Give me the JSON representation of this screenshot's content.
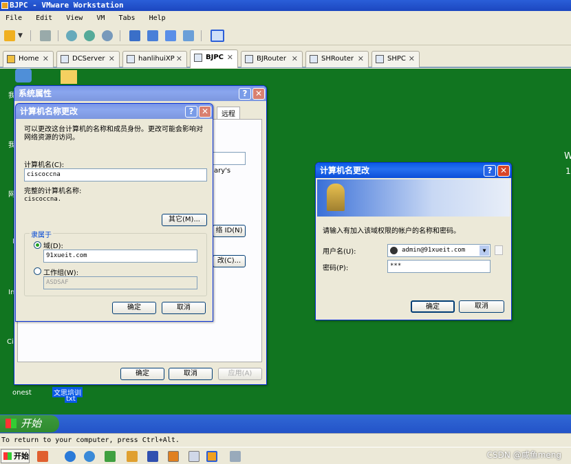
{
  "vmware": {
    "title": "BJPC - VMware Workstation",
    "menu": [
      "File",
      "Edit",
      "View",
      "VM",
      "Tabs",
      "Help"
    ],
    "tabs": [
      {
        "label": "Home",
        "active": false
      },
      {
        "label": "DCServer",
        "active": false
      },
      {
        "label": "hanlihuiXP",
        "active": false
      },
      {
        "label": "BJPC",
        "active": true
      },
      {
        "label": "BJRouter",
        "active": false
      },
      {
        "label": "SHRouter",
        "active": false
      },
      {
        "label": "SHPC",
        "active": false
      }
    ],
    "status": "To return to your computer, press Ctrl+Alt.",
    "host_start": "开始",
    "watermark": "CSDN @咸鱼meng"
  },
  "guest": {
    "start": "开始",
    "desktop_labels": [
      "onest",
      "文思培训",
      "txt"
    ]
  },
  "sys_props": {
    "title": "系统属性",
    "tab_remote": "远程",
    "partial_text": "ary's",
    "partial_btn1": "络 ID(N)",
    "partial_btn2": "改(C)...",
    "ok": "确定",
    "cancel": "取消",
    "apply": "应用(A)"
  },
  "name_change": {
    "title": "计算机名称更改",
    "desc": "可以更改这台计算机的名称和成员身份。更改可能会影响对网络资源的访问。",
    "computer_name_label": "计算机名(C):",
    "computer_name": "ciscoccna",
    "full_name_label": "完整的计算机名称:",
    "full_name": "ciscoccna.",
    "other_button": "其它(M)...",
    "member_of": "隶属于",
    "domain_label": "域(D):",
    "domain_value": "91xueit.com",
    "workgroup_label": "工作组(W):",
    "workgroup_value": "ASDSAF",
    "ok": "确定",
    "cancel": "取消"
  },
  "cred_dialog": {
    "title": "计算机名更改",
    "prompt": "请输入有加入该域权限的帐户的名称和密码。",
    "user_label": "用户名(U):",
    "user_value": "admin@91xueit.com",
    "pass_label": "密码(P):",
    "pass_value": "***",
    "ok": "确定",
    "cancel": "取消"
  },
  "colors": {
    "desktop": "#117520",
    "xp_title": "#0a5ae8",
    "close": "#d84628"
  }
}
